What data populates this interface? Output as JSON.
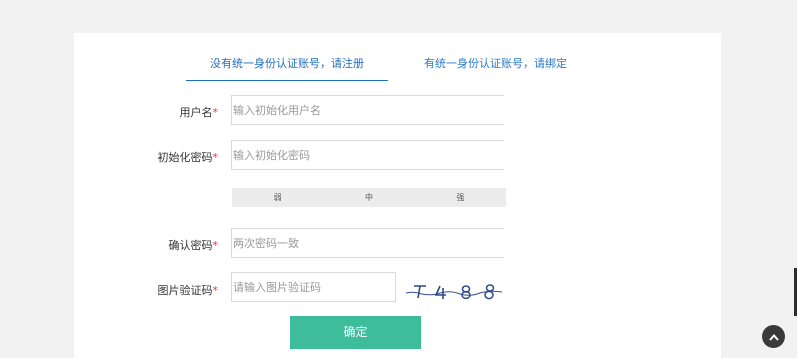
{
  "tabs": {
    "active_label": "没有统一身份认证账号，请注册",
    "other_label": "有统一身份认证账号，请绑定"
  },
  "form": {
    "username": {
      "label": "用户名",
      "required_mark": "*",
      "placeholder": "输入初始化用户名"
    },
    "password": {
      "label": "初始化密码",
      "required_mark": "*",
      "placeholder": "输入初始化密码"
    },
    "strength": {
      "levels": [
        "弱",
        "中",
        "强"
      ]
    },
    "confirm": {
      "label": "确认密码",
      "required_mark": "*",
      "placeholder": "两次密码一致"
    },
    "captcha": {
      "label": "图片验证码",
      "required_mark": "*",
      "placeholder": "请输入图片验证码",
      "image_text": "7 4 8 8"
    },
    "submit_label": "确定"
  },
  "icons": {
    "scroll_top": "chevron-up-icon"
  },
  "colors": {
    "accent": "#1f6fbf",
    "button": "#3dbd9c",
    "required": "#e23a3a"
  }
}
